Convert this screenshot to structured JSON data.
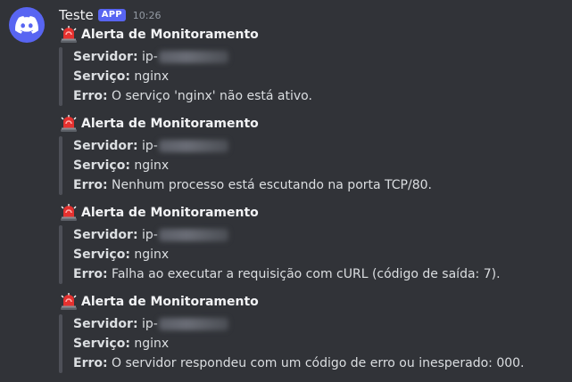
{
  "message": {
    "author": "Teste",
    "badge": "APP",
    "timestamp": "10:26"
  },
  "alerts": [
    {
      "title": "Alerta de Monitoramento",
      "server_label": "Servidor:",
      "server_value": "ip-",
      "service_label": "Serviço:",
      "service_value": "nginx",
      "error_label": "Erro:",
      "error_value": "O serviço 'nginx' não está ativo."
    },
    {
      "title": "Alerta de Monitoramento",
      "server_label": "Servidor:",
      "server_value": "ip-",
      "service_label": "Serviço:",
      "service_value": "nginx",
      "error_label": "Erro:",
      "error_value": "Nenhum processo está escutando na porta TCP/80."
    },
    {
      "title": "Alerta de Monitoramento",
      "server_label": "Servidor:",
      "server_value": "ip-",
      "service_label": "Serviço:",
      "service_value": "nginx",
      "error_label": "Erro:",
      "error_value": "Falha ao executar a requisição com cURL (código de saída: 7)."
    },
    {
      "title": "Alerta de Monitoramento",
      "server_label": "Servidor:",
      "server_value": "ip-",
      "service_label": "Serviço:",
      "service_value": "nginx",
      "error_label": "Erro:",
      "error_value": "O servidor respondeu com um código de erro ou inesperado: 000."
    }
  ],
  "icons": {
    "avatar": "discord-logo-icon",
    "alert": "police-siren-icon"
  },
  "colors": {
    "background": "#313338",
    "brand": "#5865f2",
    "siren_red": "#e5312f"
  }
}
